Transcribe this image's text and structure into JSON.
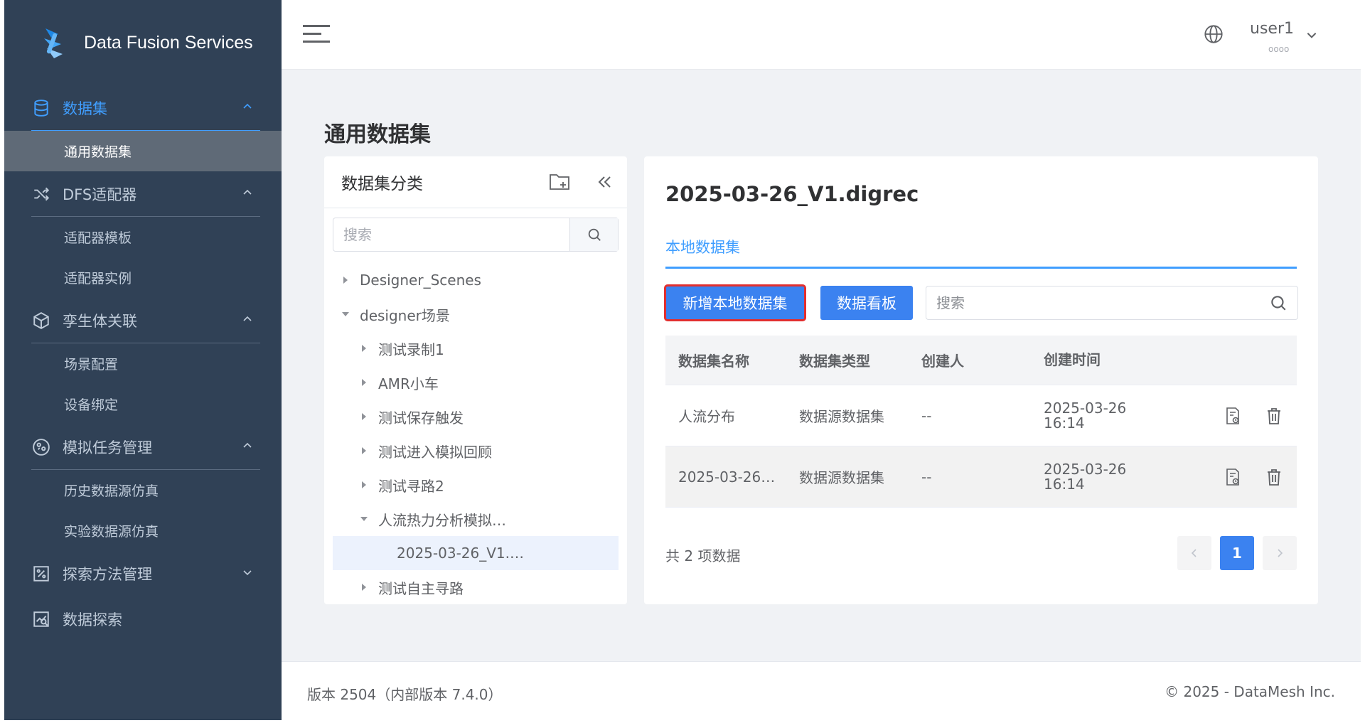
{
  "brand": {
    "name": "Data Fusion Services"
  },
  "sidebar": {
    "groups": [
      {
        "label": "数据集",
        "items": [
          {
            "label": "通用数据集"
          }
        ]
      },
      {
        "label": "DFS适配器",
        "items": [
          {
            "label": "适配器模板"
          },
          {
            "label": "适配器实例"
          }
        ]
      },
      {
        "label": "孪生体关联",
        "items": [
          {
            "label": "场景配置"
          },
          {
            "label": "设备绑定"
          }
        ]
      },
      {
        "label": "模拟任务管理",
        "items": [
          {
            "label": "历史数据源仿真"
          },
          {
            "label": "实验数据源仿真"
          }
        ]
      },
      {
        "label": "探索方法管理"
      },
      {
        "label": "数据探索"
      }
    ]
  },
  "header": {
    "user": "user1",
    "user_sub": "oooo"
  },
  "page": {
    "title": "通用数据集"
  },
  "tree_panel": {
    "title": "数据集分类",
    "search_placeholder": "搜索",
    "nodes": [
      {
        "label": "Designer_Scenes"
      },
      {
        "label": "designer场景"
      },
      {
        "label": "测试录制1"
      },
      {
        "label": "AMR小车"
      },
      {
        "label": "测试保存触发"
      },
      {
        "label": "测试进入模拟回顾"
      },
      {
        "label": "测试寻路2"
      },
      {
        "label": "人流热力分析模拟…"
      },
      {
        "label": "2025-03-26_V1.…"
      },
      {
        "label": "测试自主寻路"
      }
    ]
  },
  "detail": {
    "title": "2025-03-26_V1.digrec",
    "tab": "本地数据集",
    "add_button": "新增本地数据集",
    "board_button": "数据看板",
    "search_placeholder": "搜索",
    "columns": [
      "数据集名称",
      "数据集类型",
      "创建人",
      "创建时间"
    ],
    "rows": [
      {
        "name": "人流分布",
        "type": "数据源数据集",
        "creator": "--",
        "date": "2025-03-26",
        "time": "16:14"
      },
      {
        "name": "2025-03-26…",
        "type": "数据源数据集",
        "creator": "--",
        "date": "2025-03-26",
        "time": "16:14"
      }
    ],
    "total": "共 2 项数据",
    "current_page": "1"
  },
  "footer": {
    "version": "版本 2504（内部版本 7.4.0）",
    "copyright": "© 2025 - DataMesh Inc."
  },
  "colors": {
    "sidebar_bg": "#304156",
    "accent": "#409eff",
    "primary_button": "#3b82f0",
    "highlight_outline": "#e22f2f"
  }
}
